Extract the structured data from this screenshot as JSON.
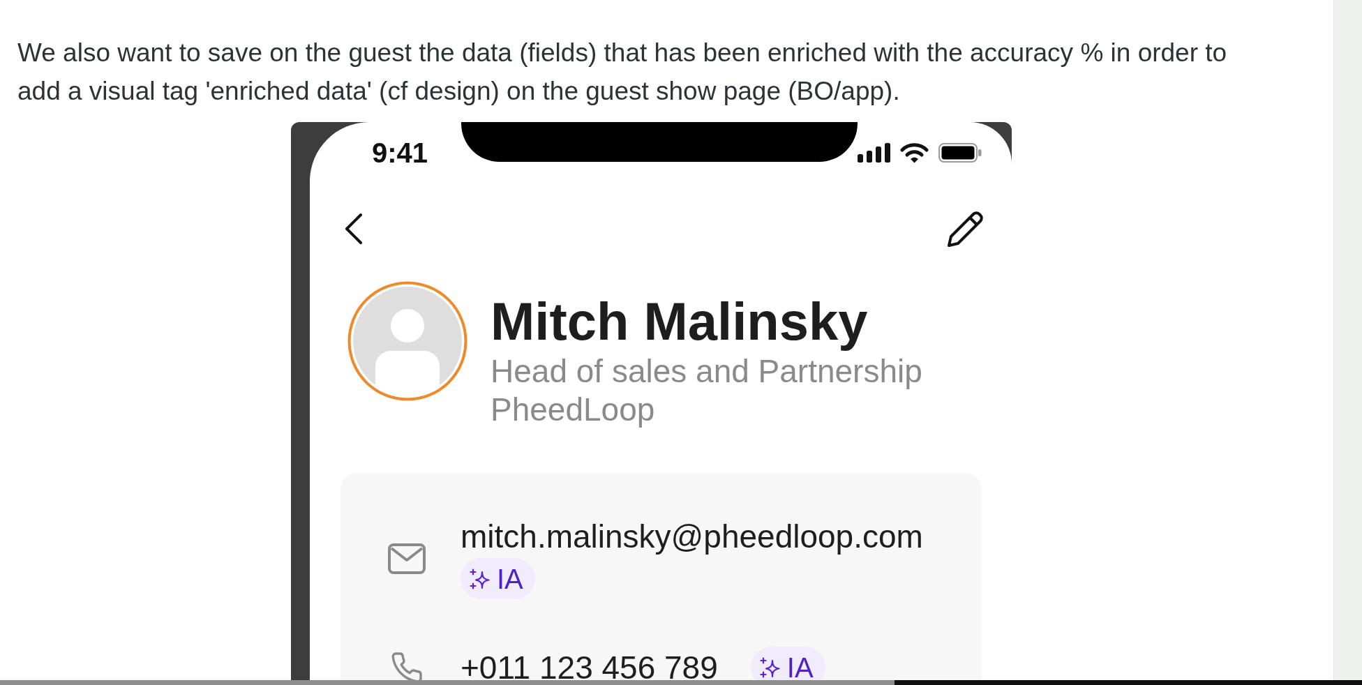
{
  "description": {
    "text": "We also want to save on the guest the data (fields) that has been enriched with the accuracy % in order to add a visual tag 'enriched data' (cf design) on the guest show page (BO/app)."
  },
  "phone": {
    "status_bar": {
      "time": "9:41"
    },
    "profile": {
      "name": "Mitch Malinsky",
      "job_title": "Head of sales and Partnership",
      "company": "PheedLoop"
    },
    "contact_fields": [
      {
        "kind": "email",
        "value": "mitch.malinsky@pheedloop.com",
        "tag": "IA"
      },
      {
        "kind": "phone",
        "value": "+011 123 456 789",
        "tag": "IA"
      }
    ]
  }
}
